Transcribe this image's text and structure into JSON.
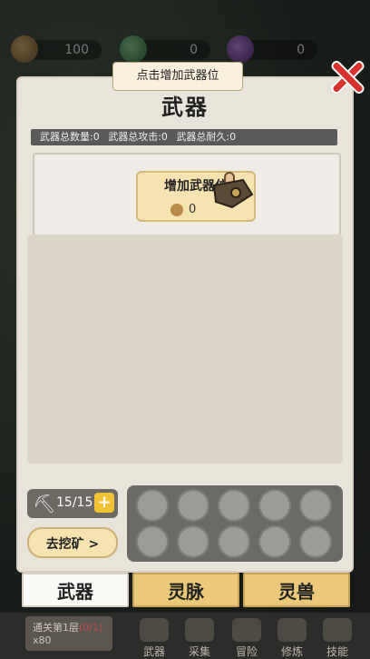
{
  "resources": [
    {
      "name": "coin",
      "value": "100"
    },
    {
      "name": "jade",
      "value": "0"
    },
    {
      "name": "soul",
      "value": "0"
    }
  ],
  "panel": {
    "title": "武器",
    "stats": {
      "count": "武器总数量:0",
      "attack": "武器总攻击:0",
      "durability": "武器总耐久:0"
    },
    "add_slot": {
      "label": "增加武器位",
      "cost": "0"
    },
    "tooltip": "点击增加武器位"
  },
  "pickaxe": {
    "value": "15/15",
    "plus": "+"
  },
  "mine_button": "去挖矿 >",
  "tabs": [
    {
      "label": "武器",
      "active": true
    },
    {
      "label": "灵脉",
      "active": false
    },
    {
      "label": "灵兽",
      "active": false
    }
  ],
  "bottom": {
    "level_label": "通关第1层",
    "level_progress": "(0/1)",
    "reward": "x80",
    "nav": [
      "武器",
      "采集",
      "冒险",
      "修炼",
      "技能"
    ]
  }
}
